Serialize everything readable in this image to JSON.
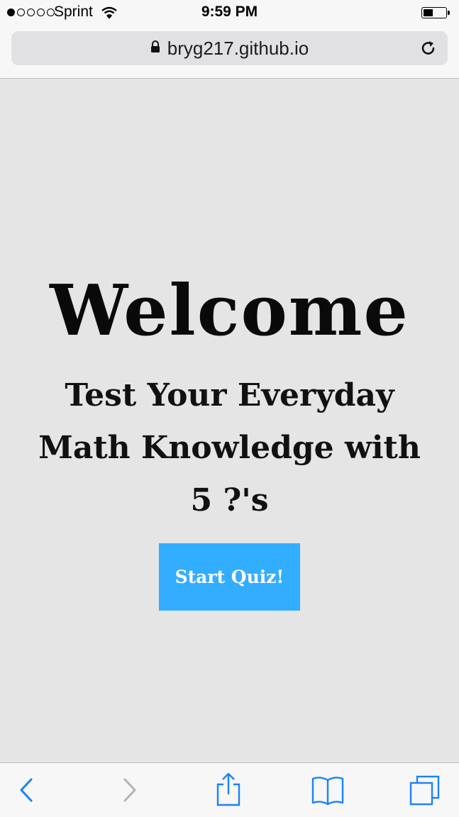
{
  "status_bar": {
    "carrier": "Sprint",
    "time": "9:59 PM",
    "signal_strength": 1,
    "signal_max": 5,
    "battery_level": 0.45
  },
  "browser": {
    "url": "bryg217.github.io"
  },
  "page": {
    "title": "Welcome",
    "subtitle": "Test Your Everyday Math Knowledge with 5 ?'s",
    "start_button_label": "Start Quiz!"
  },
  "colors": {
    "page_background": "#e5e5e5",
    "button_background": "#33adff",
    "button_text": "#ffffff",
    "toolbar_icon_blue": "#1a82fb",
    "toolbar_icon_disabled": "#b3b3b3"
  },
  "toolbar": {
    "icons": [
      "back-icon",
      "forward-icon",
      "share-icon",
      "bookmarks-icon",
      "tabs-icon"
    ]
  }
}
